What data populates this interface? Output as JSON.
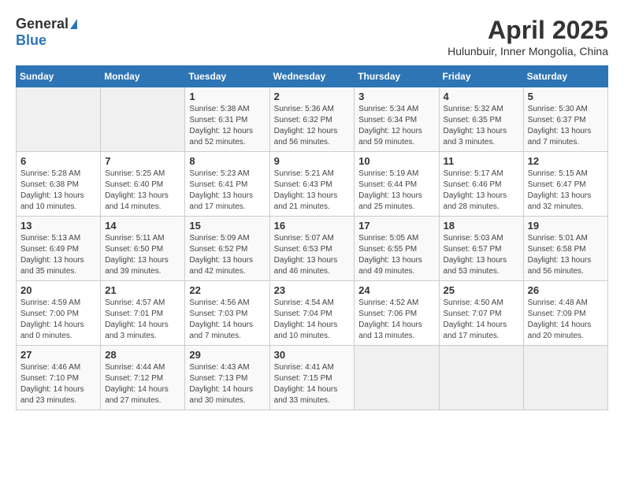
{
  "logo": {
    "general": "General",
    "blue": "Blue"
  },
  "title": "April 2025",
  "subtitle": "Hulunbuir, Inner Mongolia, China",
  "days_of_week": [
    "Sunday",
    "Monday",
    "Tuesday",
    "Wednesday",
    "Thursday",
    "Friday",
    "Saturday"
  ],
  "weeks": [
    [
      {
        "empty": true
      },
      {
        "empty": true
      },
      {
        "day": 1,
        "sunrise": "5:38 AM",
        "sunset": "6:31 PM",
        "daylight": "12 hours and 52 minutes."
      },
      {
        "day": 2,
        "sunrise": "5:36 AM",
        "sunset": "6:32 PM",
        "daylight": "12 hours and 56 minutes."
      },
      {
        "day": 3,
        "sunrise": "5:34 AM",
        "sunset": "6:34 PM",
        "daylight": "12 hours and 59 minutes."
      },
      {
        "day": 4,
        "sunrise": "5:32 AM",
        "sunset": "6:35 PM",
        "daylight": "13 hours and 3 minutes."
      },
      {
        "day": 5,
        "sunrise": "5:30 AM",
        "sunset": "6:37 PM",
        "daylight": "13 hours and 7 minutes."
      }
    ],
    [
      {
        "day": 6,
        "sunrise": "5:28 AM",
        "sunset": "6:38 PM",
        "daylight": "13 hours and 10 minutes."
      },
      {
        "day": 7,
        "sunrise": "5:25 AM",
        "sunset": "6:40 PM",
        "daylight": "13 hours and 14 minutes."
      },
      {
        "day": 8,
        "sunrise": "5:23 AM",
        "sunset": "6:41 PM",
        "daylight": "13 hours and 17 minutes."
      },
      {
        "day": 9,
        "sunrise": "5:21 AM",
        "sunset": "6:43 PM",
        "daylight": "13 hours and 21 minutes."
      },
      {
        "day": 10,
        "sunrise": "5:19 AM",
        "sunset": "6:44 PM",
        "daylight": "13 hours and 25 minutes."
      },
      {
        "day": 11,
        "sunrise": "5:17 AM",
        "sunset": "6:46 PM",
        "daylight": "13 hours and 28 minutes."
      },
      {
        "day": 12,
        "sunrise": "5:15 AM",
        "sunset": "6:47 PM",
        "daylight": "13 hours and 32 minutes."
      }
    ],
    [
      {
        "day": 13,
        "sunrise": "5:13 AM",
        "sunset": "6:49 PM",
        "daylight": "13 hours and 35 minutes."
      },
      {
        "day": 14,
        "sunrise": "5:11 AM",
        "sunset": "6:50 PM",
        "daylight": "13 hours and 39 minutes."
      },
      {
        "day": 15,
        "sunrise": "5:09 AM",
        "sunset": "6:52 PM",
        "daylight": "13 hours and 42 minutes."
      },
      {
        "day": 16,
        "sunrise": "5:07 AM",
        "sunset": "6:53 PM",
        "daylight": "13 hours and 46 minutes."
      },
      {
        "day": 17,
        "sunrise": "5:05 AM",
        "sunset": "6:55 PM",
        "daylight": "13 hours and 49 minutes."
      },
      {
        "day": 18,
        "sunrise": "5:03 AM",
        "sunset": "6:57 PM",
        "daylight": "13 hours and 53 minutes."
      },
      {
        "day": 19,
        "sunrise": "5:01 AM",
        "sunset": "6:58 PM",
        "daylight": "13 hours and 56 minutes."
      }
    ],
    [
      {
        "day": 20,
        "sunrise": "4:59 AM",
        "sunset": "7:00 PM",
        "daylight": "14 hours and 0 minutes."
      },
      {
        "day": 21,
        "sunrise": "4:57 AM",
        "sunset": "7:01 PM",
        "daylight": "14 hours and 3 minutes."
      },
      {
        "day": 22,
        "sunrise": "4:56 AM",
        "sunset": "7:03 PM",
        "daylight": "14 hours and 7 minutes."
      },
      {
        "day": 23,
        "sunrise": "4:54 AM",
        "sunset": "7:04 PM",
        "daylight": "14 hours and 10 minutes."
      },
      {
        "day": 24,
        "sunrise": "4:52 AM",
        "sunset": "7:06 PM",
        "daylight": "14 hours and 13 minutes."
      },
      {
        "day": 25,
        "sunrise": "4:50 AM",
        "sunset": "7:07 PM",
        "daylight": "14 hours and 17 minutes."
      },
      {
        "day": 26,
        "sunrise": "4:48 AM",
        "sunset": "7:09 PM",
        "daylight": "14 hours and 20 minutes."
      }
    ],
    [
      {
        "day": 27,
        "sunrise": "4:46 AM",
        "sunset": "7:10 PM",
        "daylight": "14 hours and 23 minutes."
      },
      {
        "day": 28,
        "sunrise": "4:44 AM",
        "sunset": "7:12 PM",
        "daylight": "14 hours and 27 minutes."
      },
      {
        "day": 29,
        "sunrise": "4:43 AM",
        "sunset": "7:13 PM",
        "daylight": "14 hours and 30 minutes."
      },
      {
        "day": 30,
        "sunrise": "4:41 AM",
        "sunset": "7:15 PM",
        "daylight": "14 hours and 33 minutes."
      },
      {
        "empty": true
      },
      {
        "empty": true
      },
      {
        "empty": true
      }
    ]
  ]
}
